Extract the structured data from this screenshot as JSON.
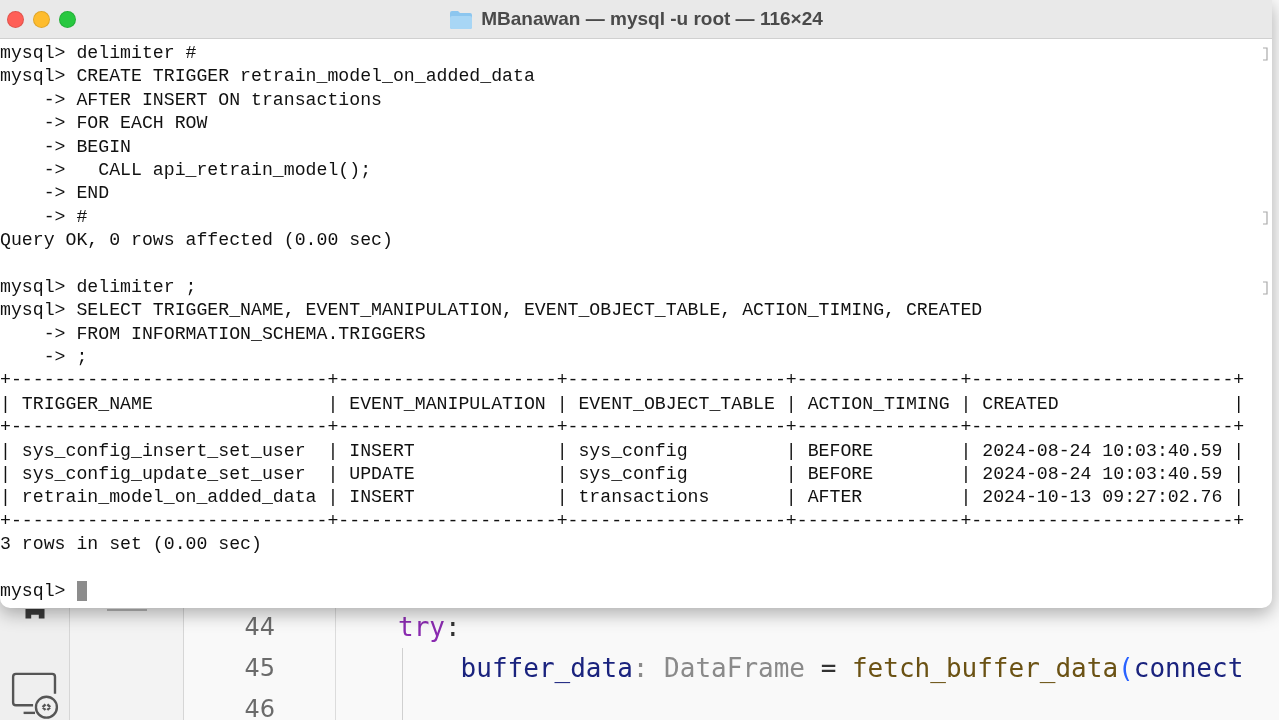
{
  "window": {
    "title": "MBanawan — mysql -u root — 116×24"
  },
  "terminal": {
    "lines": [
      {
        "kind": "text",
        "text": "mysql> delimiter #",
        "marked": true
      },
      {
        "kind": "text",
        "text": "mysql> CREATE TRIGGER retrain_model_on_added_data",
        "marked": false
      },
      {
        "kind": "text",
        "text": "    -> AFTER INSERT ON transactions",
        "marked": false
      },
      {
        "kind": "text",
        "text": "    -> FOR EACH ROW",
        "marked": false
      },
      {
        "kind": "text",
        "text": "    -> BEGIN",
        "marked": false
      },
      {
        "kind": "text",
        "text": "    ->   CALL api_retrain_model();",
        "marked": false
      },
      {
        "kind": "text",
        "text": "    -> END",
        "marked": false
      },
      {
        "kind": "text",
        "text": "    -> #",
        "marked": true
      },
      {
        "kind": "text",
        "text": "Query OK, 0 rows affected (0.00 sec)",
        "marked": false
      },
      {
        "kind": "blank",
        "marked": false
      },
      {
        "kind": "text",
        "text": "mysql> delimiter ;",
        "marked": true
      },
      {
        "kind": "text",
        "text": "mysql> SELECT TRIGGER_NAME, EVENT_MANIPULATION, EVENT_OBJECT_TABLE, ACTION_TIMING, CREATED",
        "marked": false
      },
      {
        "kind": "text",
        "text": "    -> FROM INFORMATION_SCHEMA.TRIGGERS",
        "marked": false
      },
      {
        "kind": "text",
        "text": "    -> ;",
        "marked": false
      },
      {
        "kind": "text",
        "text": "+-----------------------------+--------------------+--------------------+---------------+------------------------+",
        "marked": false
      },
      {
        "kind": "text",
        "text": "| TRIGGER_NAME                | EVENT_MANIPULATION | EVENT_OBJECT_TABLE | ACTION_TIMING | CREATED                |",
        "marked": false
      },
      {
        "kind": "text",
        "text": "+-----------------------------+--------------------+--------------------+---------------+------------------------+",
        "marked": false
      },
      {
        "kind": "text",
        "text": "| sys_config_insert_set_user  | INSERT             | sys_config         | BEFORE        | 2024-08-24 10:03:40.59 |",
        "marked": false
      },
      {
        "kind": "text",
        "text": "| sys_config_update_set_user  | UPDATE             | sys_config         | BEFORE        | 2024-08-24 10:03:40.59 |",
        "marked": false
      },
      {
        "kind": "text",
        "text": "| retrain_model_on_added_data | INSERT             | transactions       | AFTER         | 2024-10-13 09:27:02.76 |",
        "marked": false
      },
      {
        "kind": "text",
        "text": "+-----------------------------+--------------------+--------------------+---------------+------------------------+",
        "marked": false
      },
      {
        "kind": "text",
        "text": "3 rows in set (0.00 sec)",
        "marked": false
      },
      {
        "kind": "blank",
        "marked": false
      },
      {
        "kind": "prompt",
        "text": "mysql>",
        "marked": false
      }
    ]
  },
  "editor": {
    "lines": [
      {
        "number": "44",
        "tokens": [
          {
            "kind": "keyword",
            "text": "try"
          },
          {
            "kind": "punct",
            "text": ":"
          }
        ]
      },
      {
        "number": "45",
        "tokens": [
          {
            "kind": "variable",
            "text": "    buffer_data"
          },
          {
            "kind": "muted",
            "text": ": DataFrame"
          },
          {
            "kind": "punct",
            "text": " = "
          },
          {
            "kind": "function",
            "text": "fetch_buffer_data"
          },
          {
            "kind": "paren",
            "text": "("
          },
          {
            "kind": "variable",
            "text": "connect"
          }
        ]
      },
      {
        "number": "46"
      }
    ]
  }
}
